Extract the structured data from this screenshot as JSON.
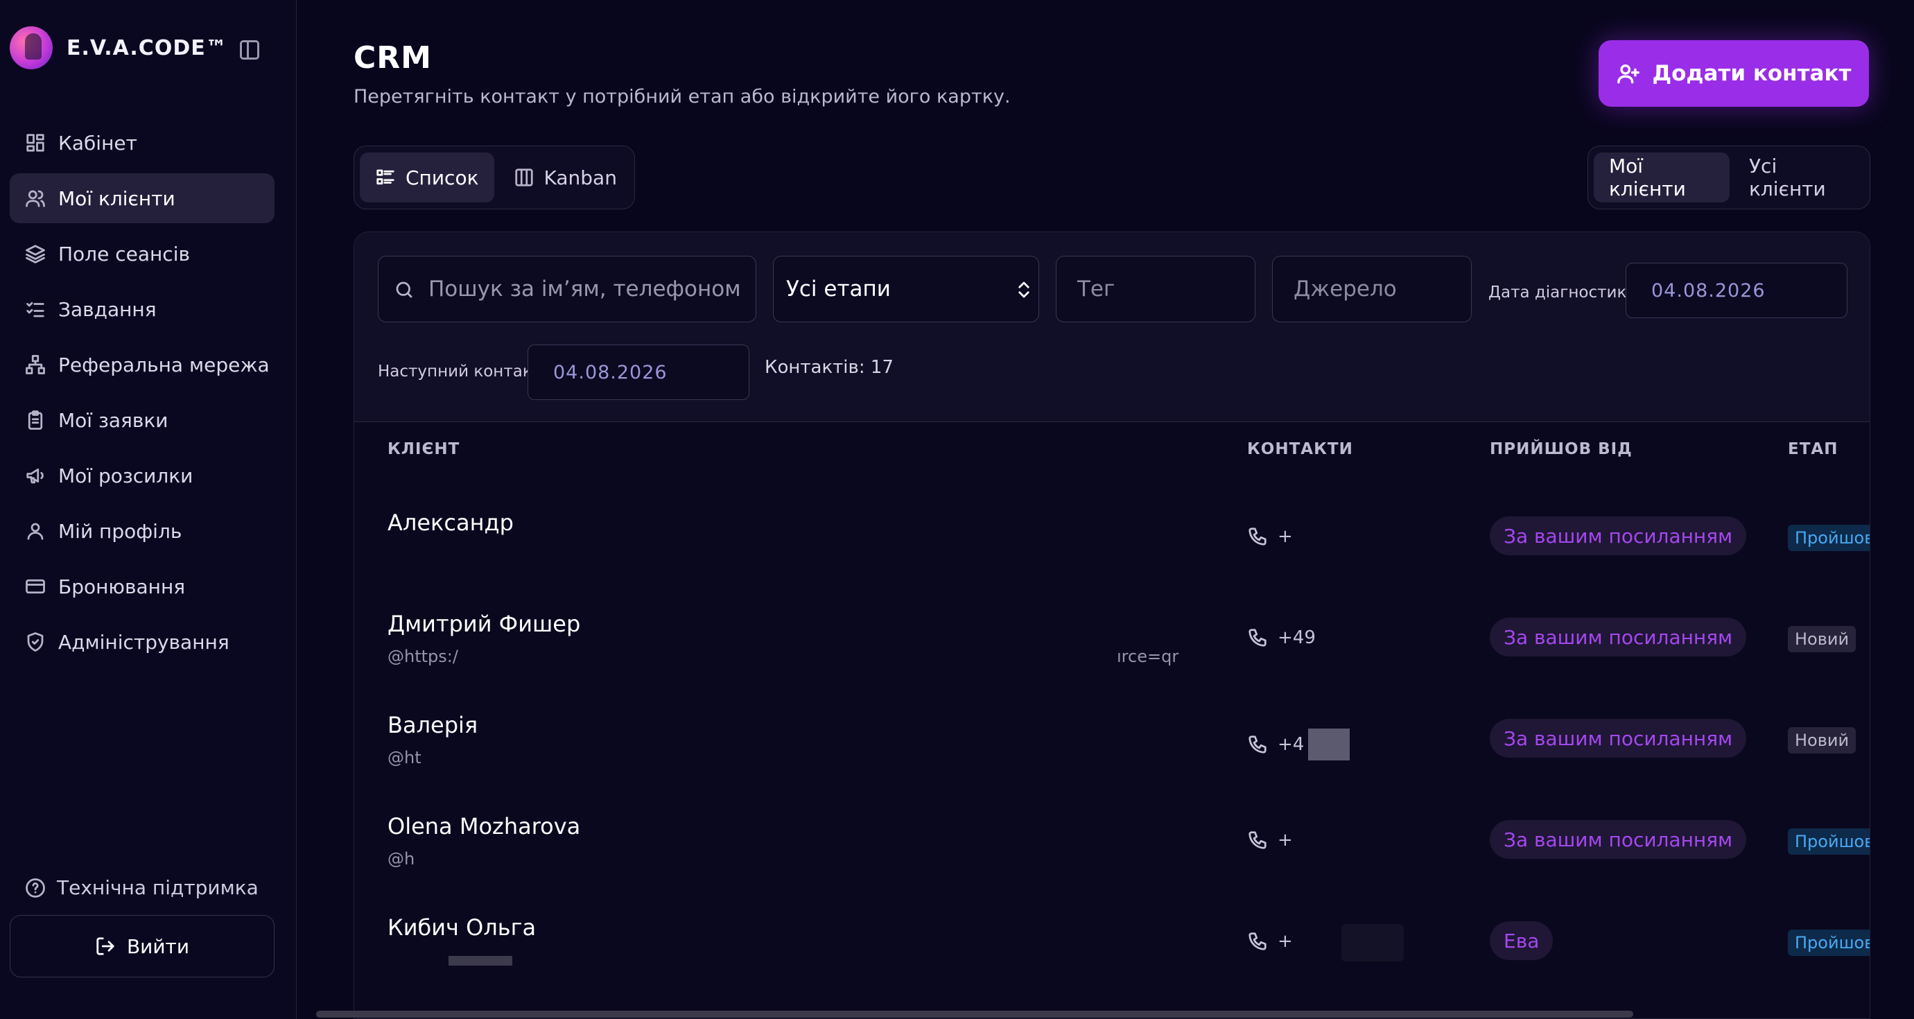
{
  "brand": {
    "name": "E.V.A.CODE™"
  },
  "sidebar": {
    "items": [
      {
        "label": "Кабінет",
        "icon": "dashboard-icon",
        "active": false
      },
      {
        "label": "Мої клієнти",
        "icon": "users-icon",
        "active": true
      },
      {
        "label": "Поле сеансів",
        "icon": "layers-icon",
        "active": false
      },
      {
        "label": "Завдання",
        "icon": "tasks-icon",
        "active": false
      },
      {
        "label": "Реферальна мережа",
        "icon": "network-icon",
        "active": false
      },
      {
        "label": "Мої заявки",
        "icon": "clipboard-icon",
        "active": false
      },
      {
        "label": "Мої розсилки",
        "icon": "megaphone-icon",
        "active": false
      },
      {
        "label": "Мій профіль",
        "icon": "user-icon",
        "active": false
      },
      {
        "label": "Бронювання",
        "icon": "card-icon",
        "active": false
      },
      {
        "label": "Адміністрування",
        "icon": "shield-icon",
        "active": false
      }
    ],
    "support": "Технічна підтримка",
    "logout": "Вийти"
  },
  "header": {
    "title": "CRM",
    "subtitle": "Перетягніть контакт у потрібний етап або відкрийте його картку.",
    "add_button": "Додати контакт"
  },
  "view_toggle": {
    "list": "Список",
    "kanban": "Kanban"
  },
  "scope_toggle": {
    "mine": "Мої клієнти",
    "all": "Усі клієнти"
  },
  "filters": {
    "search_placeholder": "Пошук за ім’ям, телефоном, є",
    "stage_value": "Усі етапи",
    "tag_placeholder": "Тег",
    "source_placeholder": "Джерело",
    "diagnostic_label": "Дата діагностики",
    "diagnostic_date": "04.08.2026",
    "next_contact_label": "Наступний контакт",
    "next_contact_date": "04.08.2026",
    "count_text": "Контактів: 17"
  },
  "table": {
    "columns": {
      "client": "КЛІЄНТ",
      "contacts": "КОНТАКТИ",
      "source": "ПРИЙШОВ ВІД",
      "stage": "ЕТАП"
    },
    "rows": [
      {
        "name": "Александр",
        "handle": "",
        "phone": "+",
        "source": "За вашим посиланням",
        "stage": "Пройшов",
        "stage_style": "blue"
      },
      {
        "name": "Дмитрий Фишер",
        "handle": "@https:/",
        "handle_tail": "ırce=qr",
        "phone": "+49",
        "source": "За вашим посиланням",
        "stage": "Новий",
        "stage_style": "gray"
      },
      {
        "name": "Валерія",
        "handle": "@ht",
        "phone": "+4",
        "source": "За вашим посиланням",
        "stage": "Новий",
        "stage_style": "gray"
      },
      {
        "name": "Olena Mozharova",
        "handle": "@h",
        "phone": "+",
        "source": "За вашим посиланням",
        "stage": "Пройшов",
        "stage_style": "blue"
      },
      {
        "name": "Кибич Ольга",
        "handle": "",
        "phone": "+",
        "source": "Ева",
        "stage": "Пройшов",
        "stage_style": "blue"
      }
    ]
  },
  "colors": {
    "accent": "#9a2de8",
    "background": "#08061c",
    "chip_text": "#a547f0",
    "stage_blue": "#4aa8f0"
  }
}
